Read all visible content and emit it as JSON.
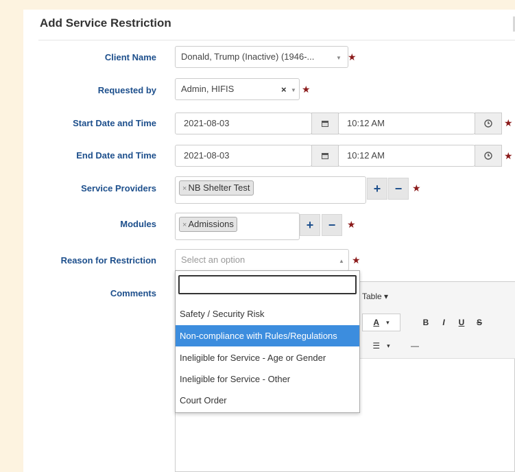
{
  "form": {
    "title": "Add Service Restriction",
    "client_name": {
      "label": "Client Name",
      "value": "Donald, Trump (Inactive) (1946-..."
    },
    "requested_by": {
      "label": "Requested by",
      "value": "Admin, HIFIS",
      "clear": "×"
    },
    "start": {
      "label": "Start Date and Time",
      "date": "2021-08-03",
      "time": "10:12 AM"
    },
    "end": {
      "label": "End Date and Time",
      "date": "2021-08-03",
      "time": "10:12 AM"
    },
    "service_providers": {
      "label": "Service Providers",
      "tags": [
        "NB Shelter Test"
      ]
    },
    "modules": {
      "label": "Modules",
      "tags": [
        "Admissions"
      ]
    },
    "reason": {
      "label": "Reason for Restriction",
      "placeholder": "Select an option"
    },
    "comments": {
      "label": "Comments"
    },
    "required_mark": "★",
    "plus": "+",
    "minus": "−",
    "tag_remove": "×"
  },
  "editor_toolbar": {
    "table_label": "Table ▾",
    "bold": "B",
    "italic": "I",
    "underline": "U",
    "strike": "S",
    "font_color": "A",
    "list": "☰",
    "dropdown": "▾",
    "hr": "—"
  },
  "dropdown": {
    "search_value": "",
    "options": [
      "Safety / Security Risk",
      "Non-compliance with Rules/Regulations",
      "Ineligible for Service - Age or Gender",
      "Ineligible for Service - Other",
      "Court Order"
    ],
    "highlighted_index": 1
  },
  "colors": {
    "label": "#1d4f8c",
    "required": "#8b1a1a",
    "highlight": "#3c8dde",
    "background": "#fdf3e0"
  },
  "icons": {
    "calendar": "calendar-icon",
    "clock": "clock-icon",
    "caret": "caret-down-icon"
  }
}
